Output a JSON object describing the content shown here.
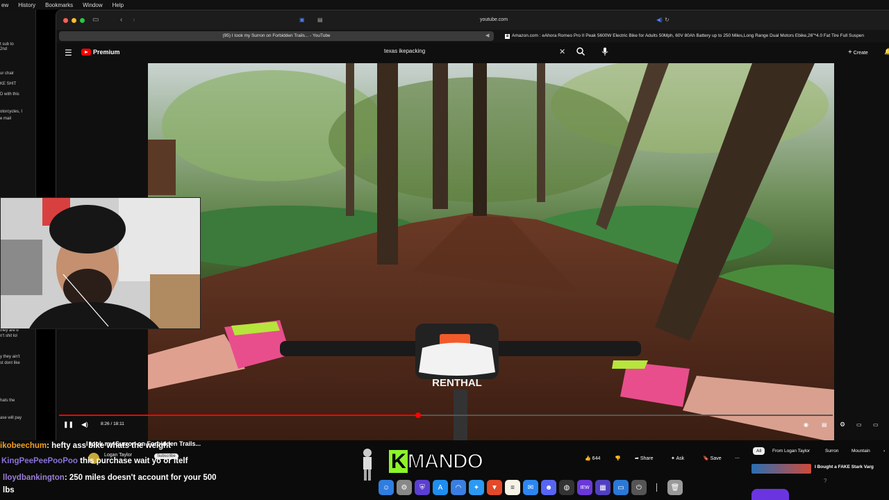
{
  "menubar": {
    "items": [
      "ew",
      "History",
      "Bookmarks",
      "Window",
      "Help"
    ]
  },
  "left_chat": {
    "lines": [
      "t sub to",
      "2nd",
      "ur chair",
      "KE SHIT",
      "D with this",
      "otorcycles, I",
      "e mail",
      "they are b",
      "n't shit lol",
      "y they ain't",
      "st dont like",
      "hats the",
      "ase will pay"
    ]
  },
  "browser": {
    "url": "youtube.com",
    "tabs": [
      {
        "label": "(95) I took my Surron on Forbidden Trails... - YouTube",
        "active": true
      },
      {
        "label": "Amazon.com : eAhora Romeo Pro II Peak 5600W Electric Bike for Adults 50Mph, 60V 80Ah Battery up to 250 Miles,Long Range Dual Motors Ebike,26\"*4.0 Fat Tire Full Suspen",
        "active": false
      }
    ]
  },
  "youtube": {
    "logo_text": "Premium",
    "search_value": "texas ikepacking",
    "create_label": "Create",
    "player": {
      "time": "8:26 / 18:11",
      "progress": 0.464,
      "handlebar_brand": "RENTHAL"
    },
    "video_title": "I took my Surron on Forbidden Trails...",
    "channel": "Logan Taylor",
    "subscribe_label": "Subscribe",
    "actions": {
      "likes": "644",
      "share": "Share",
      "ask": "Ask",
      "save": "Save"
    },
    "chips": [
      "All",
      "From Logan Taylor",
      "Surron",
      "Mountain"
    ],
    "recommended_title": "I Bought a FAKE Stark Varg"
  },
  "chat": [
    {
      "user": "ikobeechum",
      "message": ": hefty ass bike whats the weight",
      "color": "#f0a020"
    },
    {
      "user": "KingPeePeePooPoo",
      "message": "this purchase wait yo or itelf",
      "color": "#8a72d8"
    },
    {
      "user": "lloydbankington",
      "message": ": 250 miles doesn't account for your 500",
      "color": "#9b7fd6"
    },
    {
      "user": "",
      "message": "lbs",
      "color": "#ffffff"
    }
  ],
  "overlay": {
    "logo_k": "K",
    "logo_rest": "MANDO"
  },
  "colors": {
    "accent": "#ff0000",
    "background": "#0f0f0f",
    "kmando_green": "#8cf52a"
  }
}
